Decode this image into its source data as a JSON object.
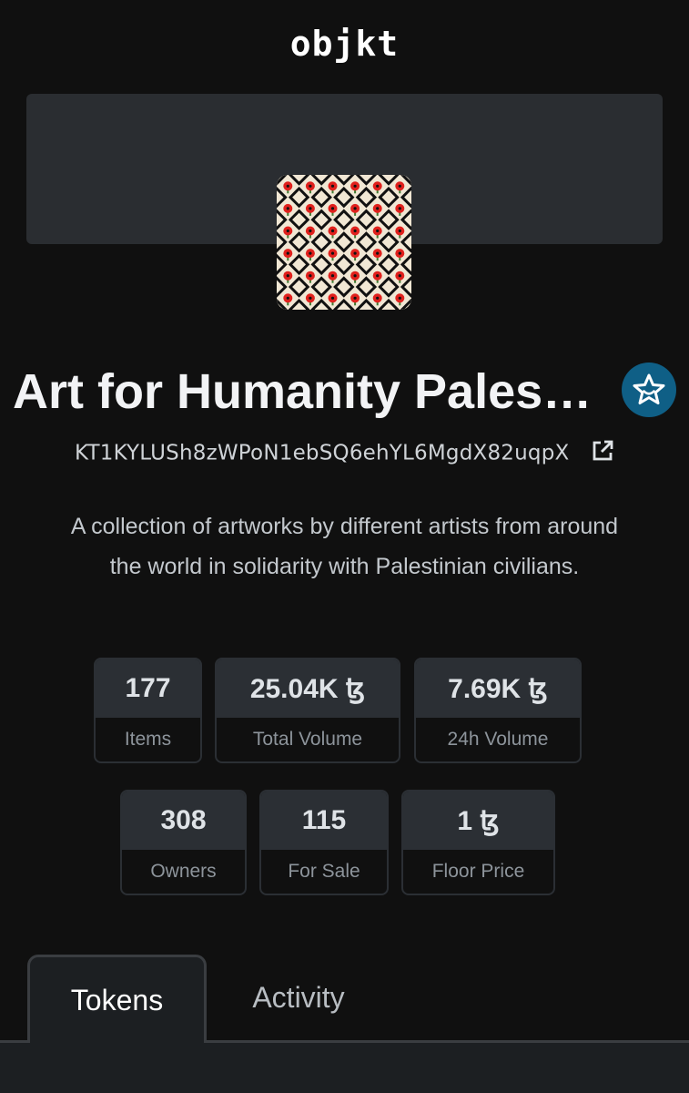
{
  "header": {
    "logo_text": "objkt"
  },
  "collection": {
    "title": "Art for Humanity Pales…",
    "address": "KT1KYLUSh8zWPoN1ebSQ6ehYL6MgdX82uqpX",
    "description": "A collection of artworks by different artists from around the world in solidarity with Palestinian civilians.",
    "verified_icon": "star-badge-icon",
    "external_link_icon": "external-link-icon"
  },
  "stats": {
    "items": {
      "value": "177",
      "label": "Items"
    },
    "total_volume": {
      "value": "25.04K ꜩ",
      "label": "Total Volume"
    },
    "volume_24h": {
      "value": "7.69K ꜩ",
      "label": "24h Volume"
    },
    "owners": {
      "value": "308",
      "label": "Owners"
    },
    "for_sale": {
      "value": "115",
      "label": "For Sale"
    },
    "floor_price": {
      "value": "1 ꜩ",
      "label": "Floor Price"
    }
  },
  "tabs": [
    {
      "label": "Tokens",
      "active": true
    },
    {
      "label": "Activity",
      "active": false
    }
  ],
  "colors": {
    "background": "#101010",
    "card": "#2b2f34",
    "accent": "#0f5f86",
    "poppy_red": "#e0201c",
    "pattern_black": "#111111",
    "pattern_cream": "#f1e7d4"
  }
}
